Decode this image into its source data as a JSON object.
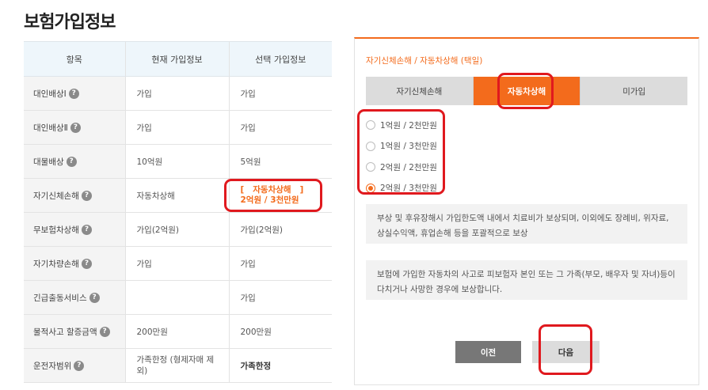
{
  "page_title": "보험가입정보",
  "table": {
    "headers": [
      "항목",
      "현재 가입정보",
      "선택 가입정보"
    ],
    "rows": [
      {
        "label": "대인배상Ⅰ",
        "help": "?",
        "current": "가입",
        "selected": "가입"
      },
      {
        "label": "대인배상Ⅱ",
        "help": "?",
        "current": "가입",
        "selected": "가입"
      },
      {
        "label": "대물배상",
        "help": "?",
        "current": "10억원",
        "selected": "5억원"
      },
      {
        "label": "자기신체손해",
        "help": "?",
        "current": "자동차상해",
        "selected_line1": "[   자동차상해   ]",
        "selected_line2": "2억원 / 3천만원"
      },
      {
        "label": "무보험차상해",
        "help": "?",
        "current": "가입(2억원)",
        "selected": "가입(2억원)"
      },
      {
        "label": "자기차량손해",
        "help": "?",
        "current": "가입",
        "selected": "가입"
      },
      {
        "label": "긴급출동서비스",
        "help": "?",
        "current": "",
        "selected": "가입"
      },
      {
        "label": "물적사고 할증금액",
        "help": "?",
        "current": "200만원",
        "selected": "200만원"
      },
      {
        "label": "운전자범위",
        "help": "?",
        "current_line1": "가족한정 (형제자매 제",
        "current_line2": "외)",
        "selected": "가족한정"
      }
    ]
  },
  "panel": {
    "title": "자기신체손해 / 자동차상해 (택일)",
    "tabs": [
      "자기신체손해",
      "자동차상해",
      "미가입"
    ],
    "active_tab": "자동차상해",
    "options": [
      "1억원 / 2천만원",
      "1억원 / 3천만원",
      "2억원 / 2천만원",
      "2억원 / 3천만원"
    ],
    "selected_option": "2억원 / 3천만원",
    "desc1": "부상 및 후유장해시 가입한도액 내에서 치료비가 보상되며, 이외에도 장례비, 위자료, 상실수익액, 휴업손해 등을 포괄적으로 보상",
    "desc2": "보험에 가입한 자동차의 사고로 피보험자 본인 또는 그 가족(부모, 배우자 및 자녀)등이 다치거나 사망한 경우에 보상합니다.",
    "prev_label": "이전",
    "next_label": "다음"
  },
  "colors": {
    "accent": "#f36b1c",
    "annotation": "#e0191e",
    "header_bg": "#eef6fb"
  }
}
